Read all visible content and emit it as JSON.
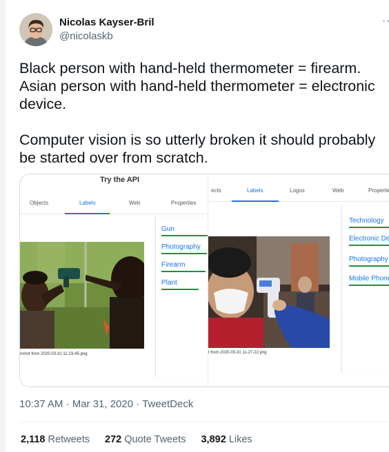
{
  "author": {
    "name": "Nicolas Kayser-Bril",
    "handle": "@nicolaskb",
    "more_label": "···"
  },
  "tweet_text": "Black person with hand-held thermometer = firearm.\nAsian person with hand-held thermometer = electronic device.\n\nComputer vision is so utterly broken it should probably be started over from scratch.",
  "left_panel": {
    "title": "Try the API",
    "tabs": [
      "Objects",
      "Labels",
      "Web",
      "Properties"
    ],
    "active_tab": "Labels",
    "labels": [
      "Gun",
      "Photography",
      "Firearm",
      "Plant"
    ],
    "caption": "nshot from 2020-03-31 11-23-45.png"
  },
  "right_panel": {
    "tabs": [
      "ects",
      "Labels",
      "Logos",
      "Web",
      "Propertie"
    ],
    "active_tab": "Labels",
    "labels": [
      "Technology",
      "Electronic De",
      "Photography",
      "Mobile Phone"
    ],
    "caption": "t from 2020-03-31 11-27-22.png"
  },
  "timestamp": "10:37 AM · Mar 31, 2020 · TweetDeck",
  "stats": {
    "retweets_count": "2,118",
    "retweets_label": "Retweets",
    "quotes_count": "272",
    "quotes_label": "Quote Tweets",
    "likes_count": "3,892",
    "likes_label": "Likes"
  },
  "colors": {
    "link_blue": "#1a73e8",
    "label_green": "#1e8e3e",
    "secondary_text": "#536471"
  }
}
